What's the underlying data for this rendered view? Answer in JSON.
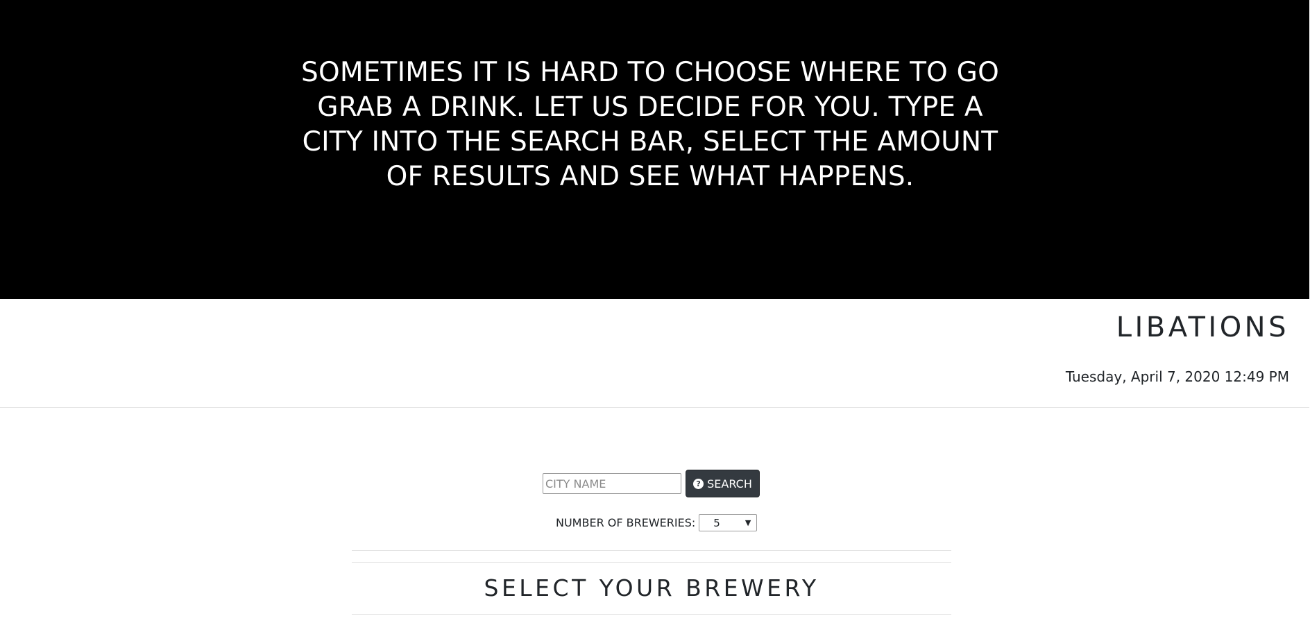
{
  "hero": {
    "lines": [
      "SOMETIMES IT IS HARD TO CHOOSE WHERE TO GO",
      "GRAB A DRINK. LET US DECIDE FOR YOU. TYPE A",
      "CITY INTO THE SEARCH BAR, SELECT THE AMOUNT",
      "OF RESULTS AND SEE WHAT HAPPENS."
    ]
  },
  "header": {
    "brand": "LIBATIONS",
    "datetime": "Tuesday, April 7, 2020 12:49 PM"
  },
  "search": {
    "placeholder": "CITY NAME",
    "value": "",
    "button_label": "SEARCH",
    "button_icon": "question-circle-icon"
  },
  "breweries_count": {
    "label": "NUMBER OF BREWERIES:",
    "selected": "5"
  },
  "results": {
    "title": "SELECT YOUR BREWERY"
  },
  "colors": {
    "hero_bg": "#000000",
    "button_bg": "#343a40",
    "text": "#212529"
  }
}
